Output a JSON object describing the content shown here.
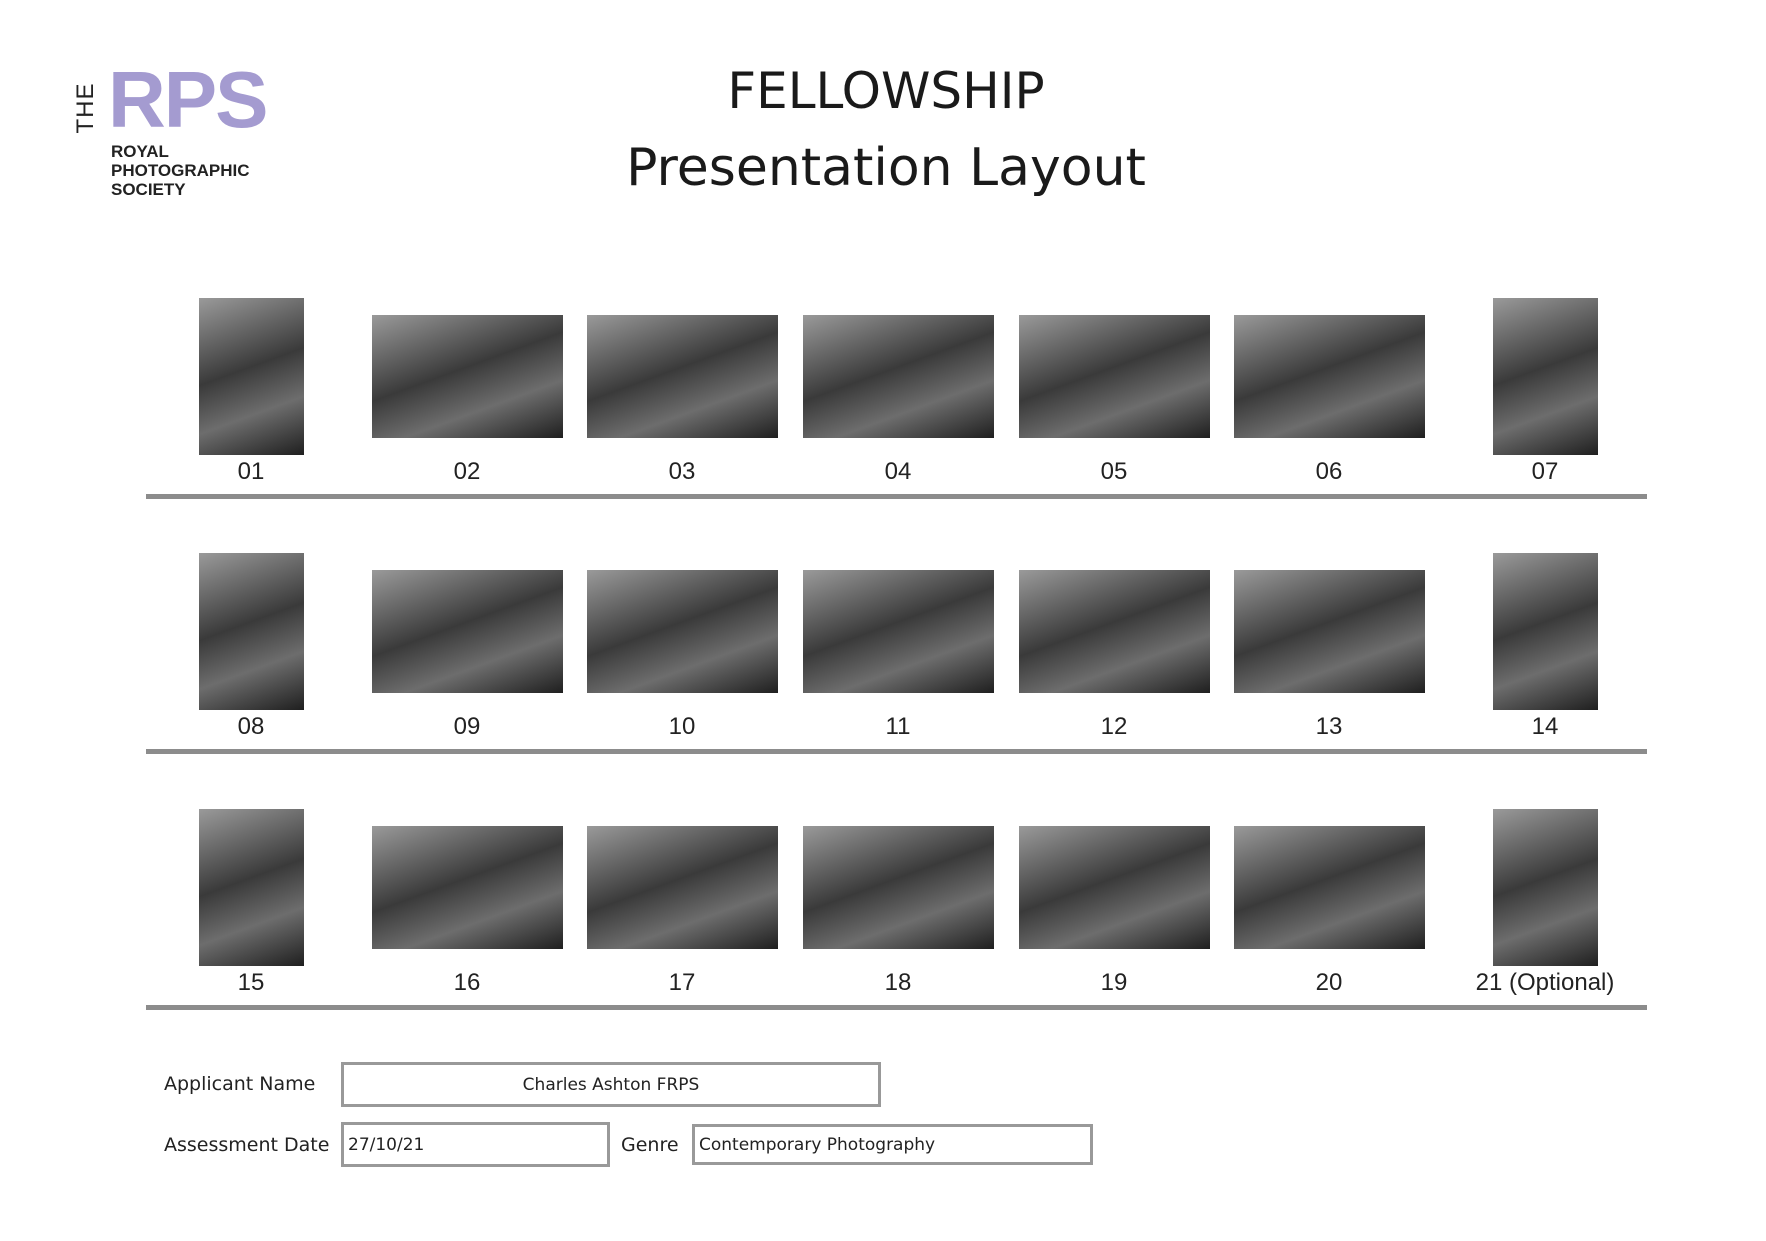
{
  "logo": {
    "the": "THE",
    "rps": "RPS",
    "sub": [
      "ROYAL",
      "PHOTOGRAPHIC",
      "SOCIETY"
    ],
    "color": "#a49bd0"
  },
  "title": "FELLOWSHIP",
  "subtitle": "Presentation Layout",
  "rows": [
    [
      {
        "label": "01",
        "orientation": "portrait"
      },
      {
        "label": "02",
        "orientation": "landscape"
      },
      {
        "label": "03",
        "orientation": "landscape"
      },
      {
        "label": "04",
        "orientation": "landscape"
      },
      {
        "label": "05",
        "orientation": "landscape"
      },
      {
        "label": "06",
        "orientation": "landscape"
      },
      {
        "label": "07",
        "orientation": "portrait"
      }
    ],
    [
      {
        "label": "08",
        "orientation": "portrait"
      },
      {
        "label": "09",
        "orientation": "landscape"
      },
      {
        "label": "10",
        "orientation": "landscape"
      },
      {
        "label": "11",
        "orientation": "landscape"
      },
      {
        "label": "12",
        "orientation": "landscape"
      },
      {
        "label": "13",
        "orientation": "landscape"
      },
      {
        "label": "14",
        "orientation": "portrait"
      }
    ],
    [
      {
        "label": "15",
        "orientation": "portrait"
      },
      {
        "label": "16",
        "orientation": "landscape"
      },
      {
        "label": "17",
        "orientation": "landscape"
      },
      {
        "label": "18",
        "orientation": "landscape"
      },
      {
        "label": "19",
        "orientation": "landscape"
      },
      {
        "label": "20",
        "orientation": "landscape"
      },
      {
        "label": "21 (Optional)",
        "orientation": "portrait"
      }
    ]
  ],
  "form": {
    "applicant_label": "Applicant Name",
    "applicant_value": "Charles Ashton FRPS",
    "date_label": "Assessment Date",
    "date_value": "27/10/21",
    "genre_label": "Genre",
    "genre_value": "Contemporary Photography"
  }
}
